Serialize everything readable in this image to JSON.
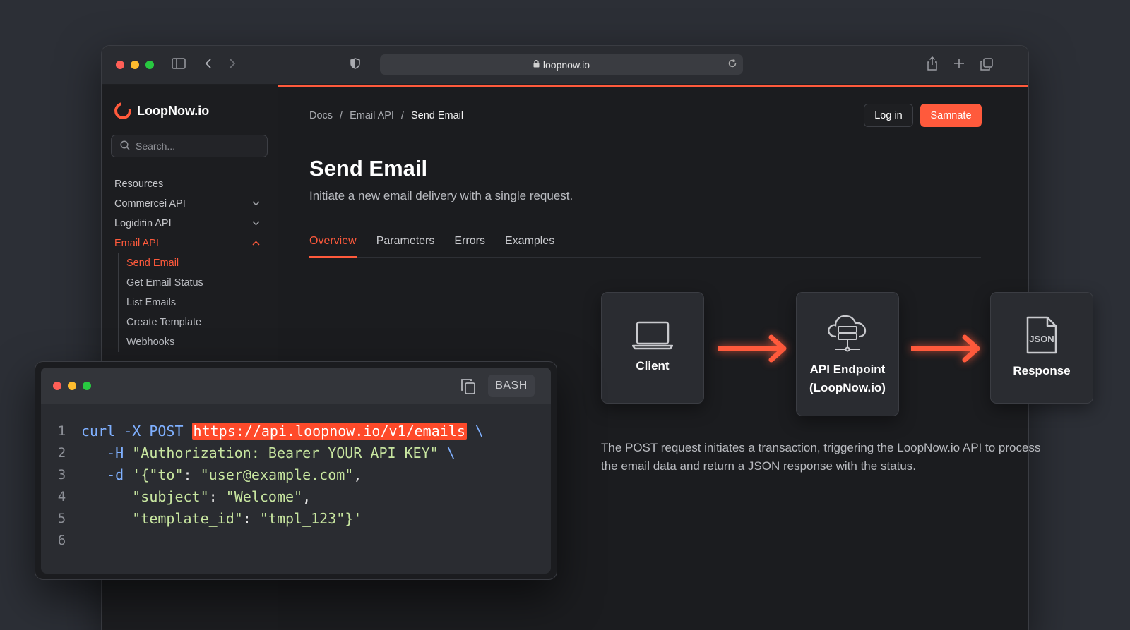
{
  "browser": {
    "url": "loopnow.io"
  },
  "sidebar": {
    "brand": "LoopNow.io",
    "search_placeholder": "Search...",
    "items": [
      {
        "label": "Resources"
      },
      {
        "label": "Commercei API"
      },
      {
        "label": "Logiditin API"
      },
      {
        "label": "Email API"
      }
    ],
    "sub_items": [
      {
        "label": "Send Email"
      },
      {
        "label": "Get Email Status"
      },
      {
        "label": "List Emails"
      },
      {
        "label": "Create Template"
      },
      {
        "label": "Webhooks"
      }
    ]
  },
  "header": {
    "breadcrumb": [
      "Docs",
      "/",
      "Email API",
      "/",
      "Send Email"
    ],
    "login_label": "Log in",
    "cta_label": "Samnate"
  },
  "page": {
    "title": "Send Email",
    "subtitle": "Initiate a new email delivery with a single request.",
    "tabs": [
      "Overview",
      "Parameters",
      "Errors",
      "Examples"
    ]
  },
  "flow": {
    "client": "Client",
    "endpoint_line1": "API Endpoint",
    "endpoint_line2": "(LoopNow.io)",
    "response": "Response",
    "json_badge": "JSON",
    "description": "The POST request initiates a transaction, triggering the LoopNow.io API to process the email data and return a JSON response with the status."
  },
  "terminal": {
    "language": "BASH",
    "line_numbers": [
      "1",
      "2",
      "3",
      "4",
      "5",
      "6"
    ],
    "l1_cmd": "curl -X POST ",
    "l1_url": "https://api.loopnow.io/v1/emails",
    "l1_tail": " \\",
    "l2_flag": "   -H ",
    "l2_str": "\"Authorization: Bearer YOUR_API_KEY\"",
    "l2_tail": " \\",
    "l3_flag": "   -d ",
    "l3_q": "'{",
    "l3_key": "\"to\"",
    "l3_colon": ": ",
    "l3_val": "\"user@example.com\"",
    "l3_tail": ",",
    "l4_indent": "      ",
    "l4_key": "\"subject\"",
    "l4_colon": ": ",
    "l4_val": "\"Welcome\"",
    "l4_tail": ",",
    "l5_indent": "      ",
    "l5_key": "\"template_id\"",
    "l5_colon": ": ",
    "l5_val": "\"tmpl_123\"",
    "l5_tail": "}'"
  },
  "colors": {
    "accent": "#ff5a3c",
    "background": "#2c2f36",
    "panel": "#1b1c1f"
  }
}
